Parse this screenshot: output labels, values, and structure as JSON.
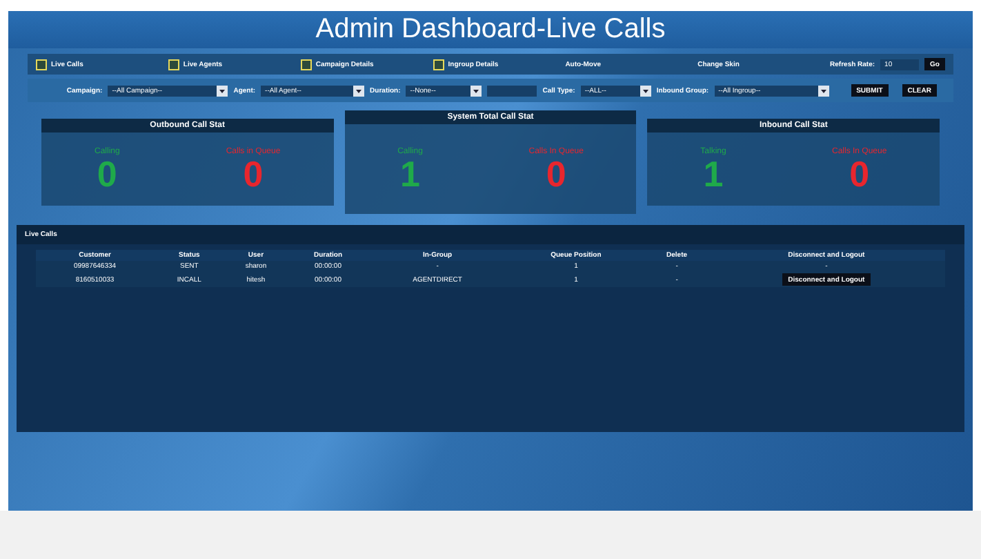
{
  "window": {
    "title": "Admin Dashboard-Live Calls"
  },
  "toolbar": {
    "checks": [
      {
        "label": "Live Calls",
        "checked": false
      },
      {
        "label": "Live Agents",
        "checked": false
      },
      {
        "label": "Campaign Details",
        "checked": false
      },
      {
        "label": "Ingroup Details",
        "checked": false
      }
    ],
    "links": [
      "Auto-Move",
      "Change Skin"
    ],
    "refresh": {
      "label": "Refresh Rate:",
      "value": "10",
      "button": "Go"
    }
  },
  "filters": {
    "fields": [
      {
        "kind": "select",
        "label": "Campaign:",
        "value": "--All Campaign--"
      },
      {
        "kind": "select",
        "label": "Agent:",
        "value": "--All Agent--"
      },
      {
        "kind": "select",
        "label": "Duration:",
        "value": "--None--"
      },
      {
        "kind": "input"
      },
      {
        "kind": "select",
        "label": "Call Type:",
        "value": "--ALL--"
      },
      {
        "kind": "select",
        "label": "Inbound Group:",
        "value": "--All Ingroup--"
      }
    ],
    "buttons": [
      "SUBMIT",
      "CLEAR"
    ]
  },
  "stats": [
    {
      "title": "Outbound Call Stat",
      "items": [
        {
          "label": "Calling",
          "value": "0",
          "color": "#1faa4a"
        },
        {
          "label": "Calls in Queue",
          "value": "0",
          "color": "#e8262e"
        }
      ]
    },
    {
      "title": "System Total Call Stat",
      "items": [
        {
          "label": "Calling",
          "value": "1",
          "color": "#1faa4a"
        },
        {
          "label": "Calls In Queue",
          "value": "0",
          "color": "#e8262e"
        }
      ]
    },
    {
      "title": "Inbound Call Stat",
      "items": [
        {
          "label": "Talking",
          "value": "1",
          "color": "#1faa4a"
        },
        {
          "label": "Calls In Queue",
          "value": "0",
          "color": "#e8262e"
        }
      ]
    }
  ],
  "live_calls": {
    "title": "Live Calls",
    "columns": [
      "Customer",
      "Status",
      "User",
      "Duration",
      "In-Group",
      "Queue Position",
      "Delete",
      "Disconnect and Logout"
    ],
    "rows": [
      {
        "cells": [
          "09987646334",
          "SENT",
          "sharon",
          "00:00:00",
          "-",
          "1",
          "-",
          "-"
        ],
        "action": false
      },
      {
        "cells": [
          "8160510033",
          "INCALL",
          "hitesh",
          "00:00:00",
          "AGENTDIRECT",
          "1",
          "-",
          "Disconnect and Logout"
        ],
        "action": true
      }
    ]
  }
}
